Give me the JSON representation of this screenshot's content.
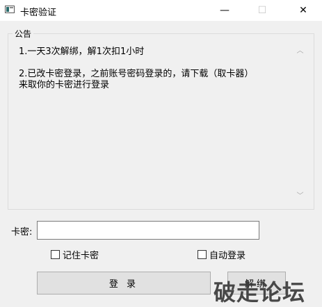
{
  "window": {
    "title": "卡密验证",
    "minimize_glyph": "—",
    "maximize_glyph": "☐",
    "close_glyph": "✕"
  },
  "notice": {
    "group_title": "公告",
    "content": "1.一天3次解绑，解1次扣1小时\n\n2.已改卡密登录，之前账号密码登录的，请下载（取卡器）\n来取你的卡密进行登录"
  },
  "scrollbar": {
    "up_glyph": "︿",
    "down_glyph": "﹀"
  },
  "form": {
    "key_label": "卡密:",
    "key_value": "",
    "remember_label": "记住卡密",
    "remember_checked": false,
    "autologin_label": "自动登录",
    "autologin_checked": false
  },
  "buttons": {
    "login_label": "登 录",
    "unbind_label": "解绑"
  },
  "watermark": {
    "text": "破走论坛"
  }
}
